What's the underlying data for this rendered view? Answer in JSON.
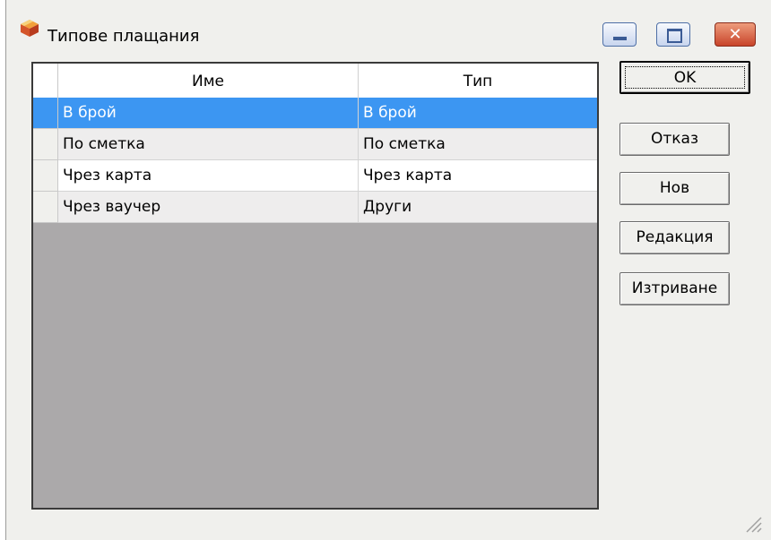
{
  "window": {
    "title": "Типове плащания"
  },
  "grid": {
    "columns": [
      "Име",
      "Тип"
    ],
    "rows": [
      {
        "name": "В брой",
        "type": "В брой"
      },
      {
        "name": "По сметка",
        "type": "По сметка"
      },
      {
        "name": "Чрез карта",
        "type": "Чрез карта"
      },
      {
        "name": "Чрез ваучер",
        "type": "Други"
      }
    ],
    "selected_index": 0
  },
  "buttons": {
    "ok": "OK",
    "cancel": "Отказ",
    "new": "Нов",
    "edit": "Редакция",
    "delete": "Изтриване"
  },
  "colors": {
    "selection": "#3c96f2",
    "grid_empty": "#aba9aa",
    "window_bg": "#f0f0ed"
  }
}
